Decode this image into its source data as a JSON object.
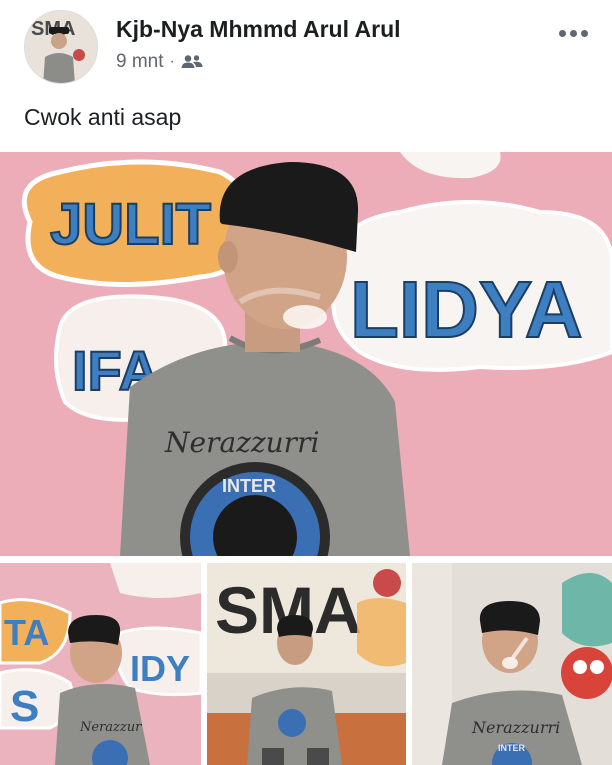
{
  "post": {
    "author": "Kjb-Nya Mhmmd Arul Arul",
    "timestamp": "9 mnt",
    "separator": "·",
    "audience_icon": "friends-icon",
    "more_icon": "more-options-icon",
    "caption": "Cwok anti asap"
  },
  "avatar": {
    "wall_text": "SMA"
  },
  "main_photo": {
    "wall_texts": [
      "JULIT",
      "LIDYA",
      "IFA"
    ],
    "shirt_text": "Nerazzurri",
    "badge_text": "INTER"
  },
  "thumbnails": [
    {
      "wall_texts": [
        "TA",
        "S",
        "IDY"
      ],
      "shirt_text": "Nerazzur"
    },
    {
      "wall_texts": [
        "SMA"
      ],
      "shirt_text": ""
    },
    {
      "wall_texts": [],
      "shirt_text": "Nerazzurri",
      "badge_text": "INTER"
    }
  ],
  "colors": {
    "wall_pink": "#eaa8b4",
    "bubble_orange": "#f2b05a",
    "letter_blue": "#3d7fc1",
    "shirt_gray": "#8f8f8b",
    "cap_black": "#1a1a1a"
  }
}
